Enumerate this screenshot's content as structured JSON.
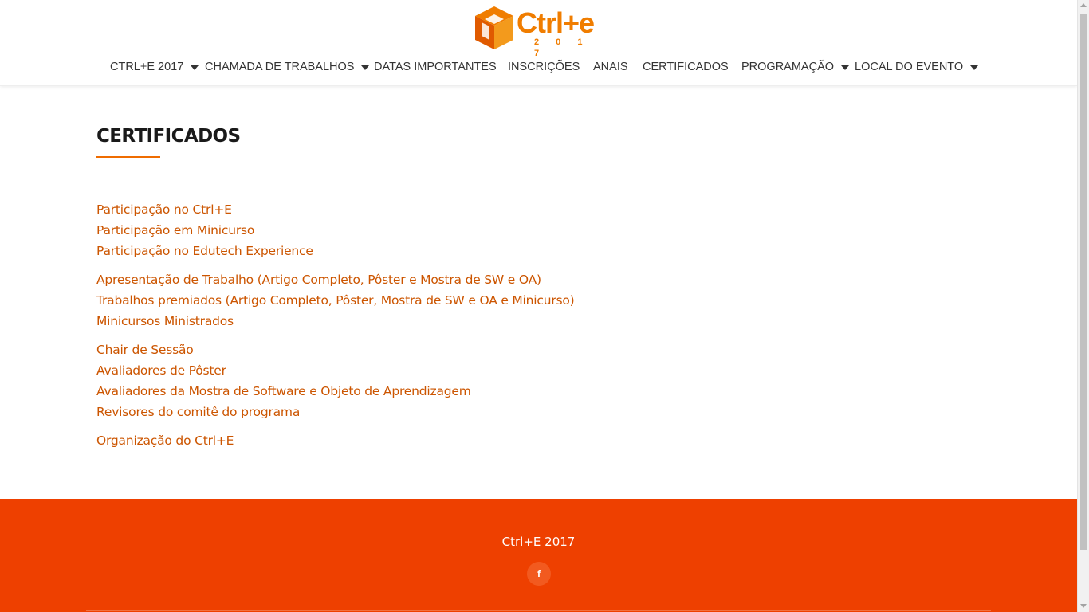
{
  "header": {
    "logo": {
      "text": "Ctrl+e",
      "year": "2 0 1 7",
      "icon": "isometric-cube-logo"
    },
    "nav": [
      {
        "label": "CTRL+E 2017",
        "has_dropdown": true
      },
      {
        "label": "CHAMADA DE TRABALHOS",
        "has_dropdown": true
      },
      {
        "label": "DATAS IMPORTANTES",
        "has_dropdown": false
      },
      {
        "label": "INSCRIÇÕES",
        "has_dropdown": false
      },
      {
        "label": "ANAIS",
        "has_dropdown": false
      },
      {
        "label": "CERTIFICADOS",
        "has_dropdown": false
      },
      {
        "label": "PROGRAMAÇÃO",
        "has_dropdown": true
      },
      {
        "label": "LOCAL DO EVENTO",
        "has_dropdown": true
      }
    ]
  },
  "main": {
    "title": "CERTIFICADOS",
    "link_groups": [
      [
        "Participação no Ctrl+E",
        "Participação em Minicurso",
        "Participação no Edutech Experience"
      ],
      [
        "Apresentação de Trabalho (Artigo Completo, Pôster e Mostra de SW e OA)",
        "Trabalhos premiados (Artigo Completo, Pôster, Mostra de SW e OA e Minicurso)",
        "Minicursos Ministrados"
      ],
      [
        "Chair de Sessão",
        "Avaliadores de Pôster",
        "Avaliadores da Mostra de Software e Objeto de Aprendizagem",
        "Revisores do comitê do programa"
      ],
      [
        "Organização do Ctrl+E"
      ]
    ]
  },
  "footer": {
    "text": "Ctrl+E 2017",
    "social_icon": "facebook-icon",
    "social_glyph": "f"
  },
  "colors": {
    "accent": "#ef6c00",
    "link": "#cc5500",
    "footer_bg": "#ee4000",
    "logo": "#f07d00"
  }
}
